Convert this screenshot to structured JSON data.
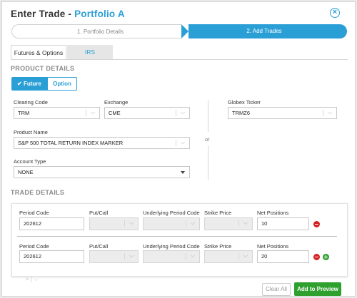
{
  "header": {
    "title_prefix": "Enter Trade - ",
    "title_portfolio": "Portfolio A",
    "close_icon": "close-circle-icon"
  },
  "steps": [
    {
      "label": "1. Portfolio Details",
      "active": false
    },
    {
      "label": "2. Add Trades",
      "active": true
    }
  ],
  "tabs": [
    {
      "label": "Futures & Options",
      "active": true
    },
    {
      "label": "IRS",
      "active": false
    }
  ],
  "product_details": {
    "heading": "PRODUCT DETAILS",
    "toggle": {
      "future": "Future",
      "option": "Option",
      "selected": "Future",
      "check_icon": "checkmark-icon"
    },
    "clearing_code": {
      "label": "Clearing Code",
      "value": "TRM"
    },
    "exchange": {
      "label": "Exchange",
      "value": "CME"
    },
    "globex_ticker": {
      "label": "Globex Ticker",
      "value": "TRMZ6"
    },
    "product_name": {
      "label": "Product Name",
      "value": "S&P 500 TOTAL RETURN INDEX MARKER"
    },
    "account_type": {
      "label": "Account Type",
      "value": "NONE"
    },
    "or_label": "or"
  },
  "trade_details": {
    "heading": "TRADE DETAILS",
    "columns": {
      "period_code": "Period Code",
      "put_call": "Put/Call",
      "underlying_period_code": "Underlying Period Code",
      "strike_price": "Strike Price",
      "net_positions": "Net Positions"
    },
    "rows": [
      {
        "period_code": "202612",
        "net_positions": "10"
      },
      {
        "period_code": "202612",
        "net_positions": "20"
      }
    ]
  },
  "footer": {
    "clear_all": "Clear All",
    "add_to_preview": "Add to Preview"
  },
  "colors": {
    "accent": "#2a9fd6",
    "success": "#2ea02e",
    "danger": "#d42020"
  }
}
